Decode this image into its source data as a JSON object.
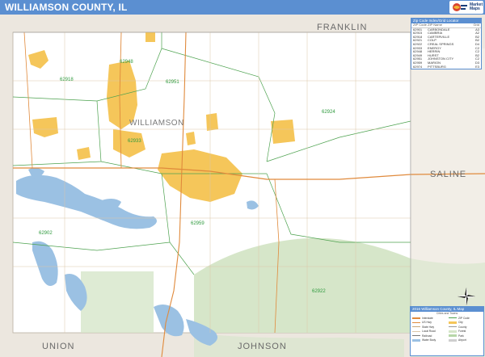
{
  "header": {
    "title": "WILLIAMSON COUNTY, IL",
    "logo_text": "Market Maps"
  },
  "colors": {
    "header_bg": "#5b8fd1",
    "land": "#ffffff",
    "neighbor_land": "#ece7df",
    "urban": "#f5c65a",
    "water": "#9bc1e3",
    "forest": "#d6e6c9",
    "highway": "#e08a3c",
    "road": "#c9a87a",
    "zip_boundary": "#4da24f"
  },
  "map": {
    "neighbors": [
      {
        "name": "FRANKLIN"
      },
      {
        "name": "SALINE"
      },
      {
        "name": "UNION"
      },
      {
        "name": "JOHNSON"
      }
    ],
    "city_labels": [
      {
        "name": "WILLIAMSON"
      }
    ],
    "zip_codes": [
      "62948",
      "62951",
      "62918",
      "62924",
      "62933",
      "62959",
      "62902",
      "62922"
    ]
  },
  "zip_table": {
    "title": "Zip Code Index/Grid Locator",
    "columns": [
      "ZIP Code",
      "ZIP Name",
      "Grid"
    ],
    "rows": [
      [
        "62901",
        "CARBONDALE",
        "A3"
      ],
      [
        "62915",
        "CAMBRIA",
        "A2"
      ],
      [
        "62918",
        "CARTERVILLE",
        "B2"
      ],
      [
        "62921",
        "COLP",
        "B2"
      ],
      [
        "62922",
        "CREAL SPRINGS",
        "D4"
      ],
      [
        "62933",
        "ENERGY",
        "C2"
      ],
      [
        "62948",
        "HERRIN",
        "C2"
      ],
      [
        "62949",
        "HURST",
        "B2"
      ],
      [
        "62951",
        "JOHNSTON CITY",
        "C2"
      ],
      [
        "62959",
        "MARION",
        "D3"
      ],
      [
        "62974",
        "PITTSBURG",
        "E3"
      ]
    ]
  },
  "legend": {
    "title": "2016 Williamson County, IL Map",
    "subtitle": "Cities and Towns",
    "left_items": [
      "Interstate",
      "US Hwy",
      "State Hwy",
      "Local Road",
      "Railroad",
      "Water Body"
    ],
    "right_items": [
      "ZIP Code",
      "City",
      "County",
      "Forest",
      "Park",
      "Airport"
    ]
  }
}
